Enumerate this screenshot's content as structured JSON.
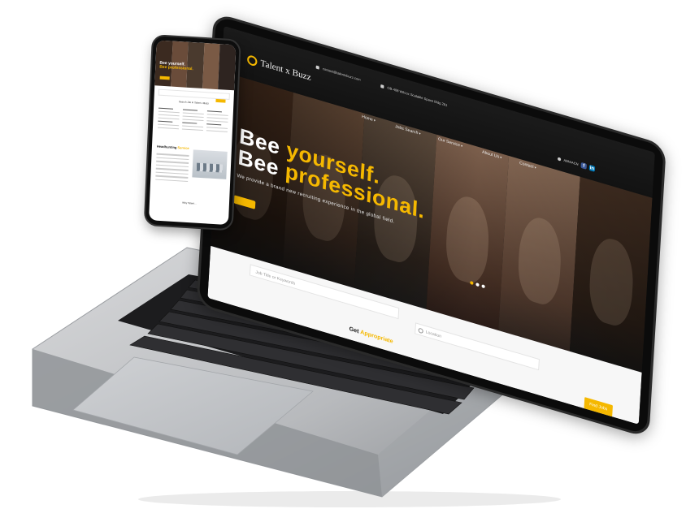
{
  "site": {
    "logo_text": "Talent x Buzz",
    "contact": {
      "email": "contact@talentxbuzz.com",
      "address": "OB-408 Wilcox Scalable Space Bldg 261",
      "phone": "ABN/ACN"
    },
    "nav": [
      "Home",
      "Jobs Search",
      "Our Service",
      "About Us",
      "Contact"
    ],
    "hero": {
      "line1_prefix": "Bee ",
      "line1_highlight": "yourself.",
      "line2_prefix": "Bee ",
      "line2_highlight": "professional.",
      "subtitle": "We provide a brand new recruiting experience in the global field."
    },
    "search": {
      "keyword_placeholder": "Job Title or Keywords",
      "location_placeholder": "Location"
    },
    "cta_band": {
      "title_prefix": "Get ",
      "title_highlight": "Appropriate",
      "button_label": "Find Jobs"
    }
  },
  "phone_site": {
    "hero_line1": "Bee yourself.",
    "hero_line2": "Bee professional.",
    "search_title": "Search Job in Talent x Buzz",
    "section_title_prefix": "Headhunting ",
    "section_title_highlight": "Service",
    "why_title": "Why Talent..."
  },
  "colors": {
    "accent": "#f5b800",
    "facebook": "#3b5998",
    "linkedin": "#0077b5"
  }
}
